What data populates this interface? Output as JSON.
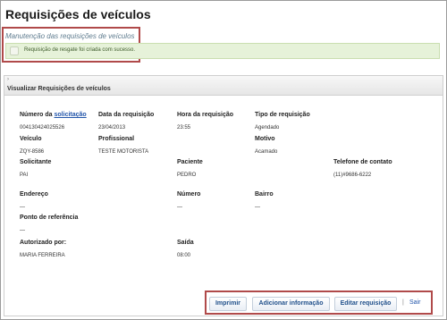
{
  "header": {
    "title": "Requisições de veículos",
    "subtitle": "Manutenção das requisições de veículos"
  },
  "message": {
    "text": "Requisição de resgate foi criada com sucesso.",
    "type": "success"
  },
  "panel": {
    "toggle_glyph": "›",
    "title": "Visualizar Requisições de veículos"
  },
  "fields": {
    "numero": {
      "label_prefix": "Número da ",
      "label_link": "solicitação",
      "value": "004130424025526"
    },
    "data": {
      "label": "Data da requisição",
      "value": "23/04/2013"
    },
    "hora": {
      "label": "Hora da requisição",
      "value": "23:55"
    },
    "tipo": {
      "label": "Tipo de requisição",
      "value": "Agendado"
    },
    "veiculo": {
      "label": "Veículo",
      "value": "ZQY-8586"
    },
    "profissional": {
      "label": "Profissional",
      "value": "TESTE MOTORISTA"
    },
    "motivo": {
      "label": "Motivo",
      "value": "Acamado"
    },
    "solicitante": {
      "label": "Solicitante",
      "value": "PAI"
    },
    "paciente": {
      "label": "Paciente",
      "value": "PEDRO"
    },
    "telefone": {
      "label": "Telefone de contato",
      "value": "(11)#9686-6222"
    },
    "endereco": {
      "label": "Endereço",
      "value": "—"
    },
    "numero_end": {
      "label": "Número",
      "value": "—"
    },
    "bairro": {
      "label": "Bairro",
      "value": "—"
    },
    "referencia": {
      "label": "Ponto de referência",
      "value": "—"
    },
    "autorizado": {
      "label": "Autorizado por:",
      "value": "MARIA FERREIRA"
    },
    "saida": {
      "label": "Saída",
      "value": "08:00"
    }
  },
  "actions": {
    "print": "Imprimir",
    "add_info": "Adicionar informação",
    "edit": "Editar requisição",
    "separator": "|",
    "exit": "Sair"
  },
  "colors": {
    "highlight": "#b04a4a",
    "success_bg": "#e6f2d9",
    "link": "#2255aa"
  }
}
